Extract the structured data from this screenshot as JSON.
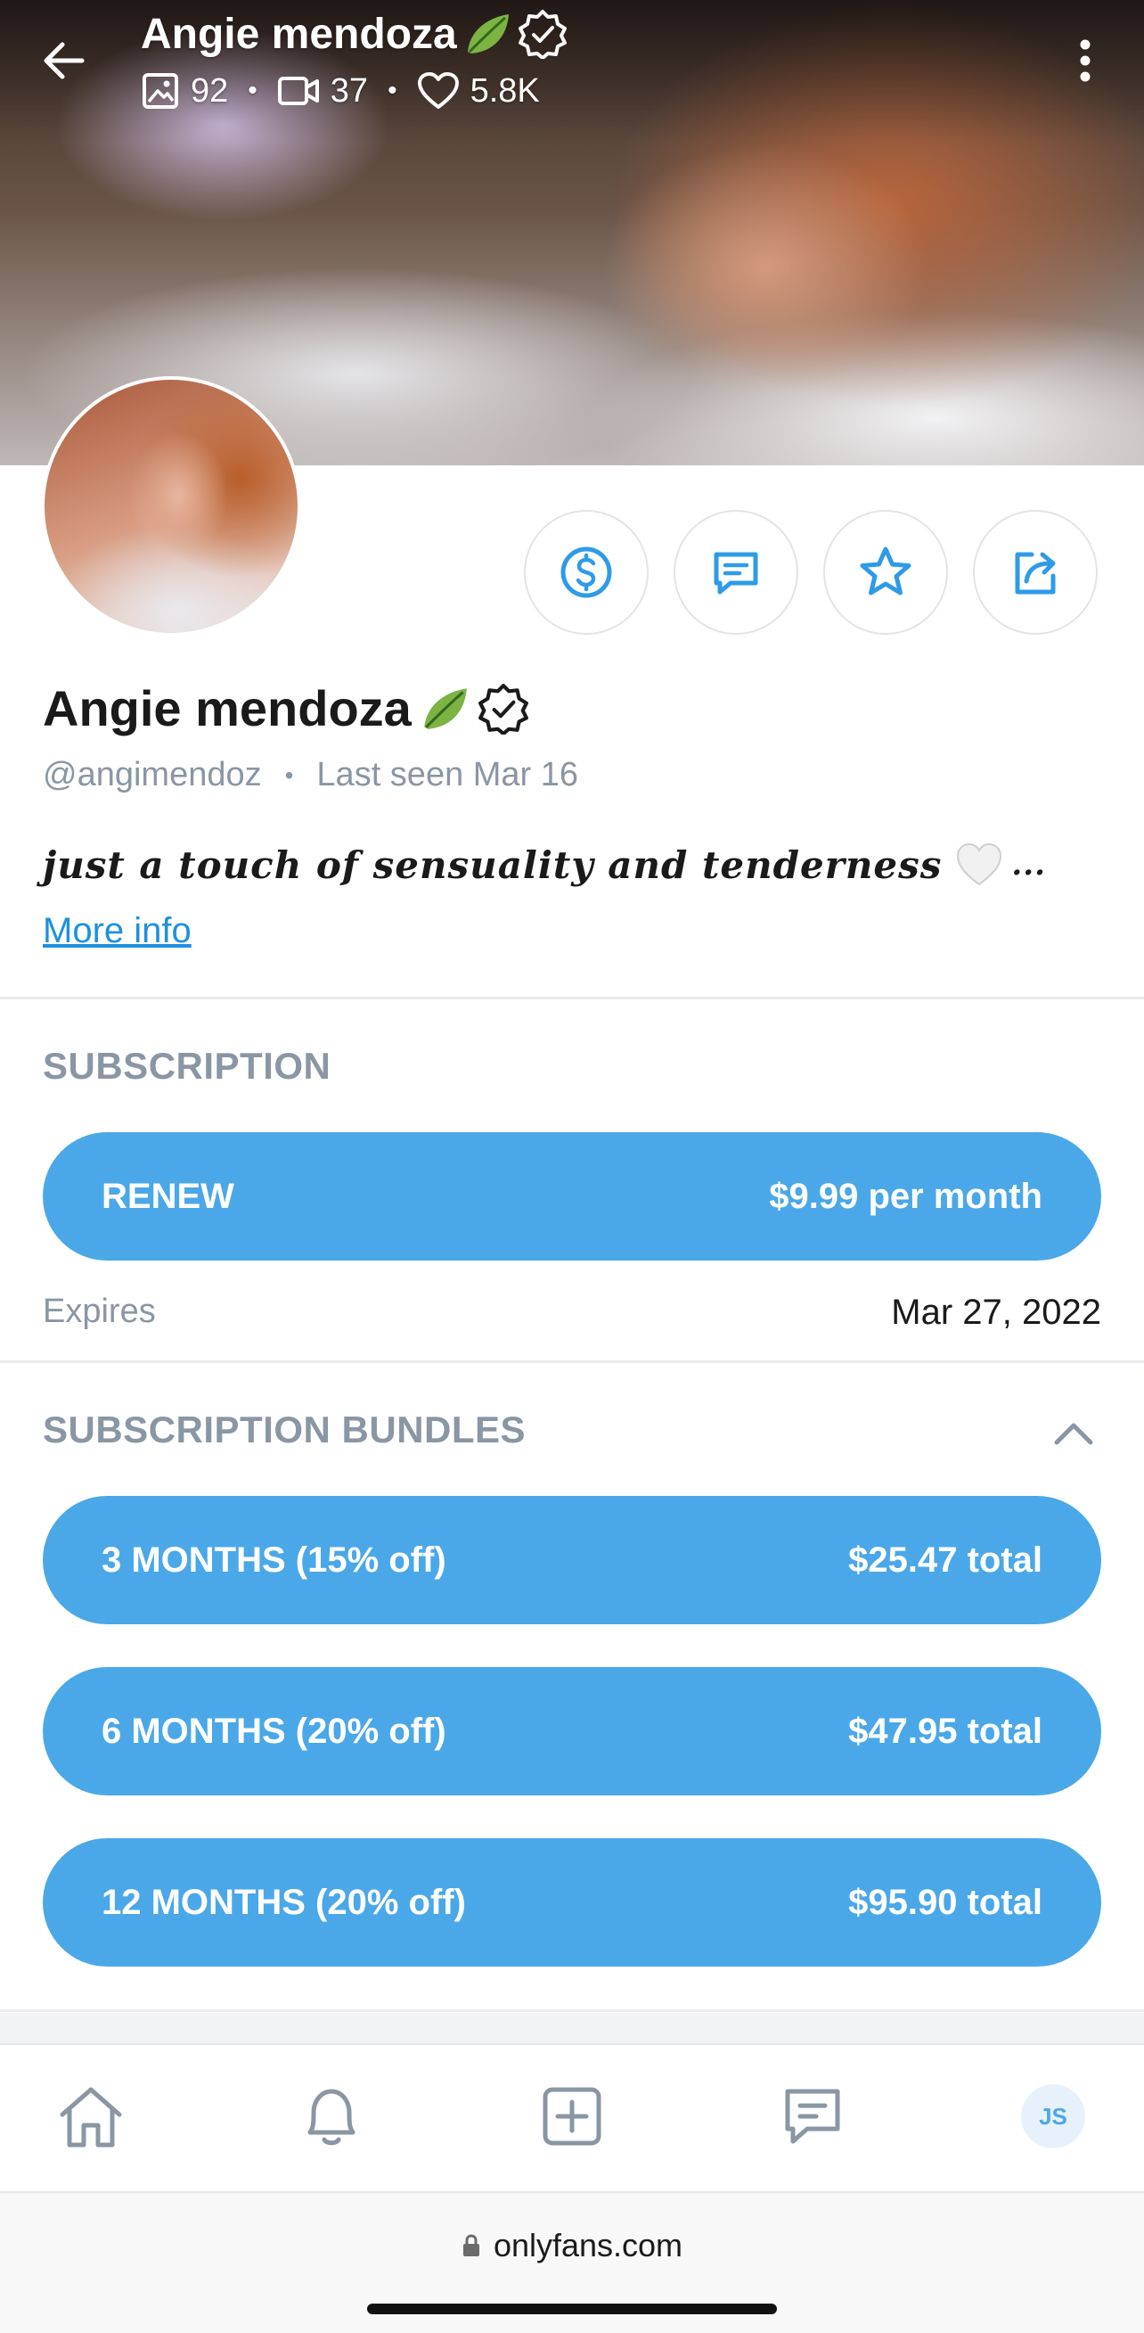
{
  "header": {
    "name": "Angie mendoza",
    "photos_count": "92",
    "videos_count": "37",
    "likes_count": "5.8K"
  },
  "profile": {
    "name": "Angie mendoza",
    "handle": "@angimendoz",
    "last_seen": "Last seen Mar 16",
    "bio": "just a touch of sensuality and tenderness",
    "bio_ellipsis": "...",
    "more_info": "More info"
  },
  "actions": [
    {
      "icon": "dollar-icon"
    },
    {
      "icon": "message-icon"
    },
    {
      "icon": "star-icon"
    },
    {
      "icon": "share-icon"
    }
  ],
  "subscription": {
    "title": "SUBSCRIPTION",
    "button_label": "RENEW",
    "button_price": "$9.99 per month",
    "expires_label": "Expires",
    "expires_date": "Mar 27, 2022"
  },
  "bundles": {
    "title": "SUBSCRIPTION BUNDLES",
    "items": [
      {
        "label": "3 MONTHS (15% off)",
        "price": "$25.47 total"
      },
      {
        "label": "6 MONTHS (20% off)",
        "price": "$47.95 total"
      },
      {
        "label": "12 MONTHS (20% off)",
        "price": "$95.90 total"
      }
    ]
  },
  "nav": {
    "avatar_initials": "JS"
  },
  "browser": {
    "url": "onlyfans.com"
  },
  "colors": {
    "accent": "#4aa8e8",
    "muted": "#8a96a3",
    "icon_blue": "#2e9be8"
  }
}
